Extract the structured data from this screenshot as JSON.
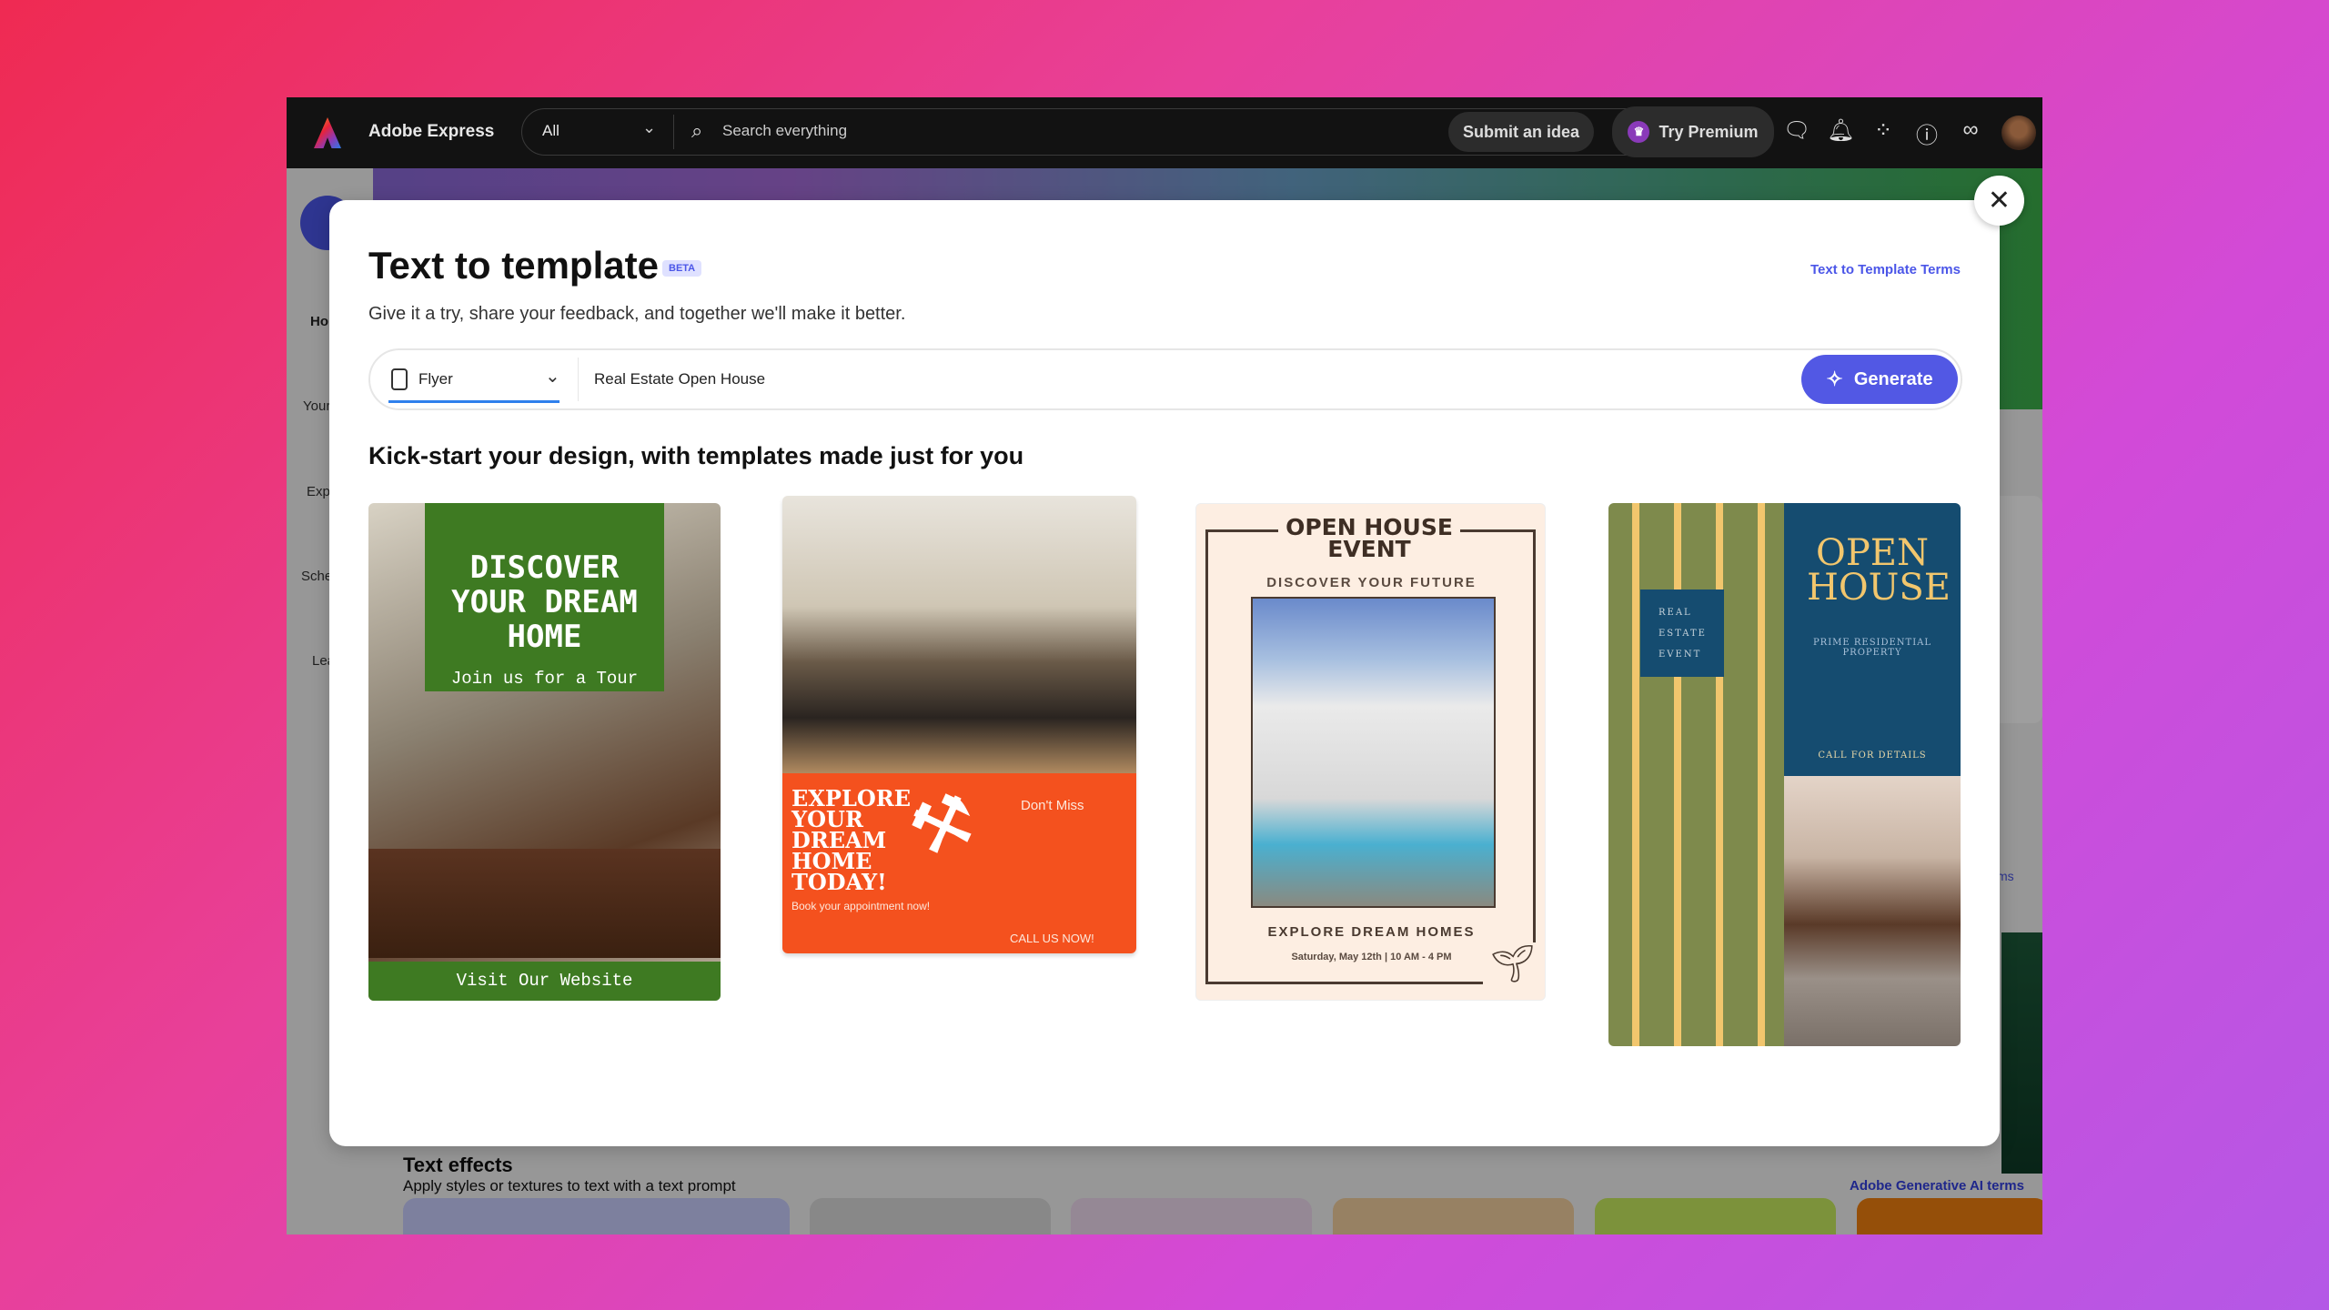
{
  "topbar": {
    "app_name": "Adobe Express",
    "scope": "All",
    "search_placeholder": "Search everything",
    "submit_idea": "Submit an idea",
    "try_premium": "Try Premium"
  },
  "sidebar": {
    "items": [
      {
        "label": "Ho"
      },
      {
        "label": "Your"
      },
      {
        "label": "Exp"
      },
      {
        "label": "Sche"
      },
      {
        "label": "Lea"
      }
    ]
  },
  "background_section": {
    "title": "Text effects",
    "subtitle": "Apply styles or textures to text with a text prompt",
    "terms": "Adobe Generative AI terms",
    "partial_link": "ms"
  },
  "modal": {
    "title": "Text to template",
    "badge": "BETA",
    "terms_link": "Text to Template Terms",
    "subtitle": "Give it a try, share your feedback, and together we'll make it better.",
    "type_select": "Flyer",
    "prompt_value": "Real Estate Open House",
    "generate": "Generate",
    "section_heading": "Kick-start your design, with templates made just for you",
    "templates": [
      {
        "headline": "DISCOVER YOUR DREAM HOME",
        "sub": "Join us for a Tour",
        "footer": "Visit Our Website"
      },
      {
        "headline": "EXPLORE YOUR DREAM HOME TODAY!",
        "aside": "Don't Miss",
        "sub": "Book your appointment now!",
        "footer": "CALL US NOW!"
      },
      {
        "headline": "OPEN HOUSE EVENT",
        "sub": "DISCOVER YOUR FUTURE",
        "tagline": "EXPLORE DREAM HOMES",
        "date": "Saturday, May 12th | 10 AM - 4 PM"
      },
      {
        "headline": "OPEN HOUSE",
        "box": "REAL ESTATE EVENT",
        "sub": "PRIME RESIDENTIAL PROPERTY",
        "footer": "CALL FOR DETAILS"
      }
    ]
  },
  "colors": {
    "accent": "#5258e4",
    "topbar": "#121212",
    "card1_green": "#3e7a22",
    "card2_orange": "#f4511e",
    "card3_bg": "#fdeee2",
    "card4_navy": "#154c70",
    "card4_olive": "#7e8a4c",
    "card4_gold": "#f2c66d"
  }
}
